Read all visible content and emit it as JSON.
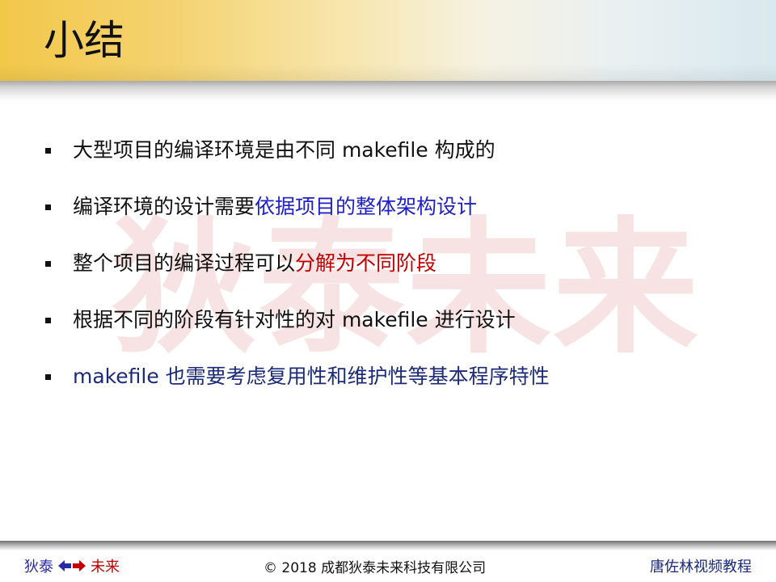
{
  "slide": {
    "title": "小结",
    "watermark": "狄泰未来",
    "bullets": [
      {
        "parts": [
          {
            "text": "大型项目的编译环境是由不同 makefile 构成的",
            "style": "normal"
          }
        ]
      },
      {
        "parts": [
          {
            "text": "编译环境的设计需要",
            "style": "normal"
          },
          {
            "text": "依据项目的整体架构设计",
            "style": "blue"
          }
        ]
      },
      {
        "parts": [
          {
            "text": "整个项目的编译过程可以",
            "style": "normal"
          },
          {
            "text": "分解为不同阶段",
            "style": "red"
          }
        ]
      },
      {
        "parts": [
          {
            "text": "根据不同的阶段有针对性的对 makefile 进行设计",
            "style": "normal"
          }
        ]
      },
      {
        "parts": [
          {
            "text": "makefile 也需要考虑复用性和维护性等基本程序特性",
            "style": "navy"
          }
        ]
      }
    ]
  },
  "footer": {
    "brand_left": "狄泰",
    "brand_right": "未来",
    "arrow_icon": "double-arrow-icon",
    "copyright": "© 2018 成都狄泰未来科技有限公司",
    "right_text": "唐佐林视频教程"
  },
  "colors": {
    "blue": "#1f1fc8",
    "red": "#c00000",
    "navy": "#1b2a7a",
    "header_gold": "#f2c84a"
  }
}
